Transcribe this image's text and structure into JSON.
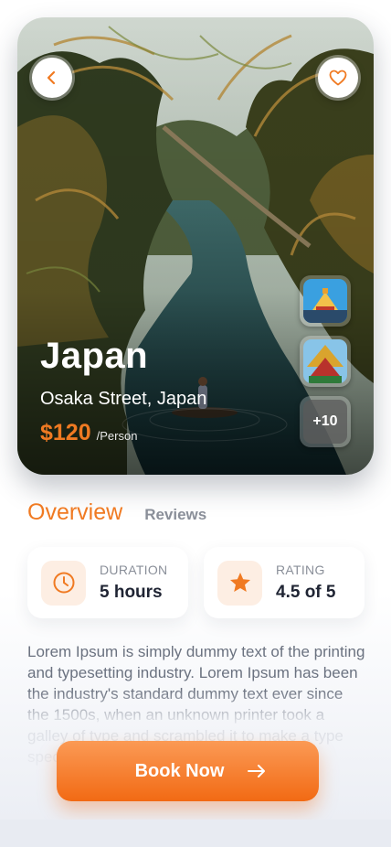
{
  "hero": {
    "title": "Japan",
    "location": "Osaka Street, Japan",
    "price": "$120",
    "price_unit": "/Person",
    "back_icon": "chevron-left-icon",
    "favorite_icon": "heart-icon",
    "gallery_more": "+10"
  },
  "tabs": {
    "active": "Overview",
    "other": "Reviews"
  },
  "stats": {
    "duration_label": "DURATION",
    "duration_value": "5 hours",
    "duration_icon": "clock-icon",
    "rating_label": "RATING",
    "rating_value": "4.5 of 5",
    "rating_icon": "star-icon"
  },
  "description": "Lorem Ipsum is simply dummy text of the printing and typesetting industry. Lorem Ipsum has been the industry's standard dummy text ever since the 1500s, when an unknown printer took a galley of type and scrambled it to make a type specimen book.",
  "book_button": {
    "label": "Book Now",
    "icon": "arrow-right-icon"
  },
  "colors": {
    "accent": "#f07a22",
    "text_dark": "#1f2433",
    "text_muted": "#8a8f99"
  }
}
